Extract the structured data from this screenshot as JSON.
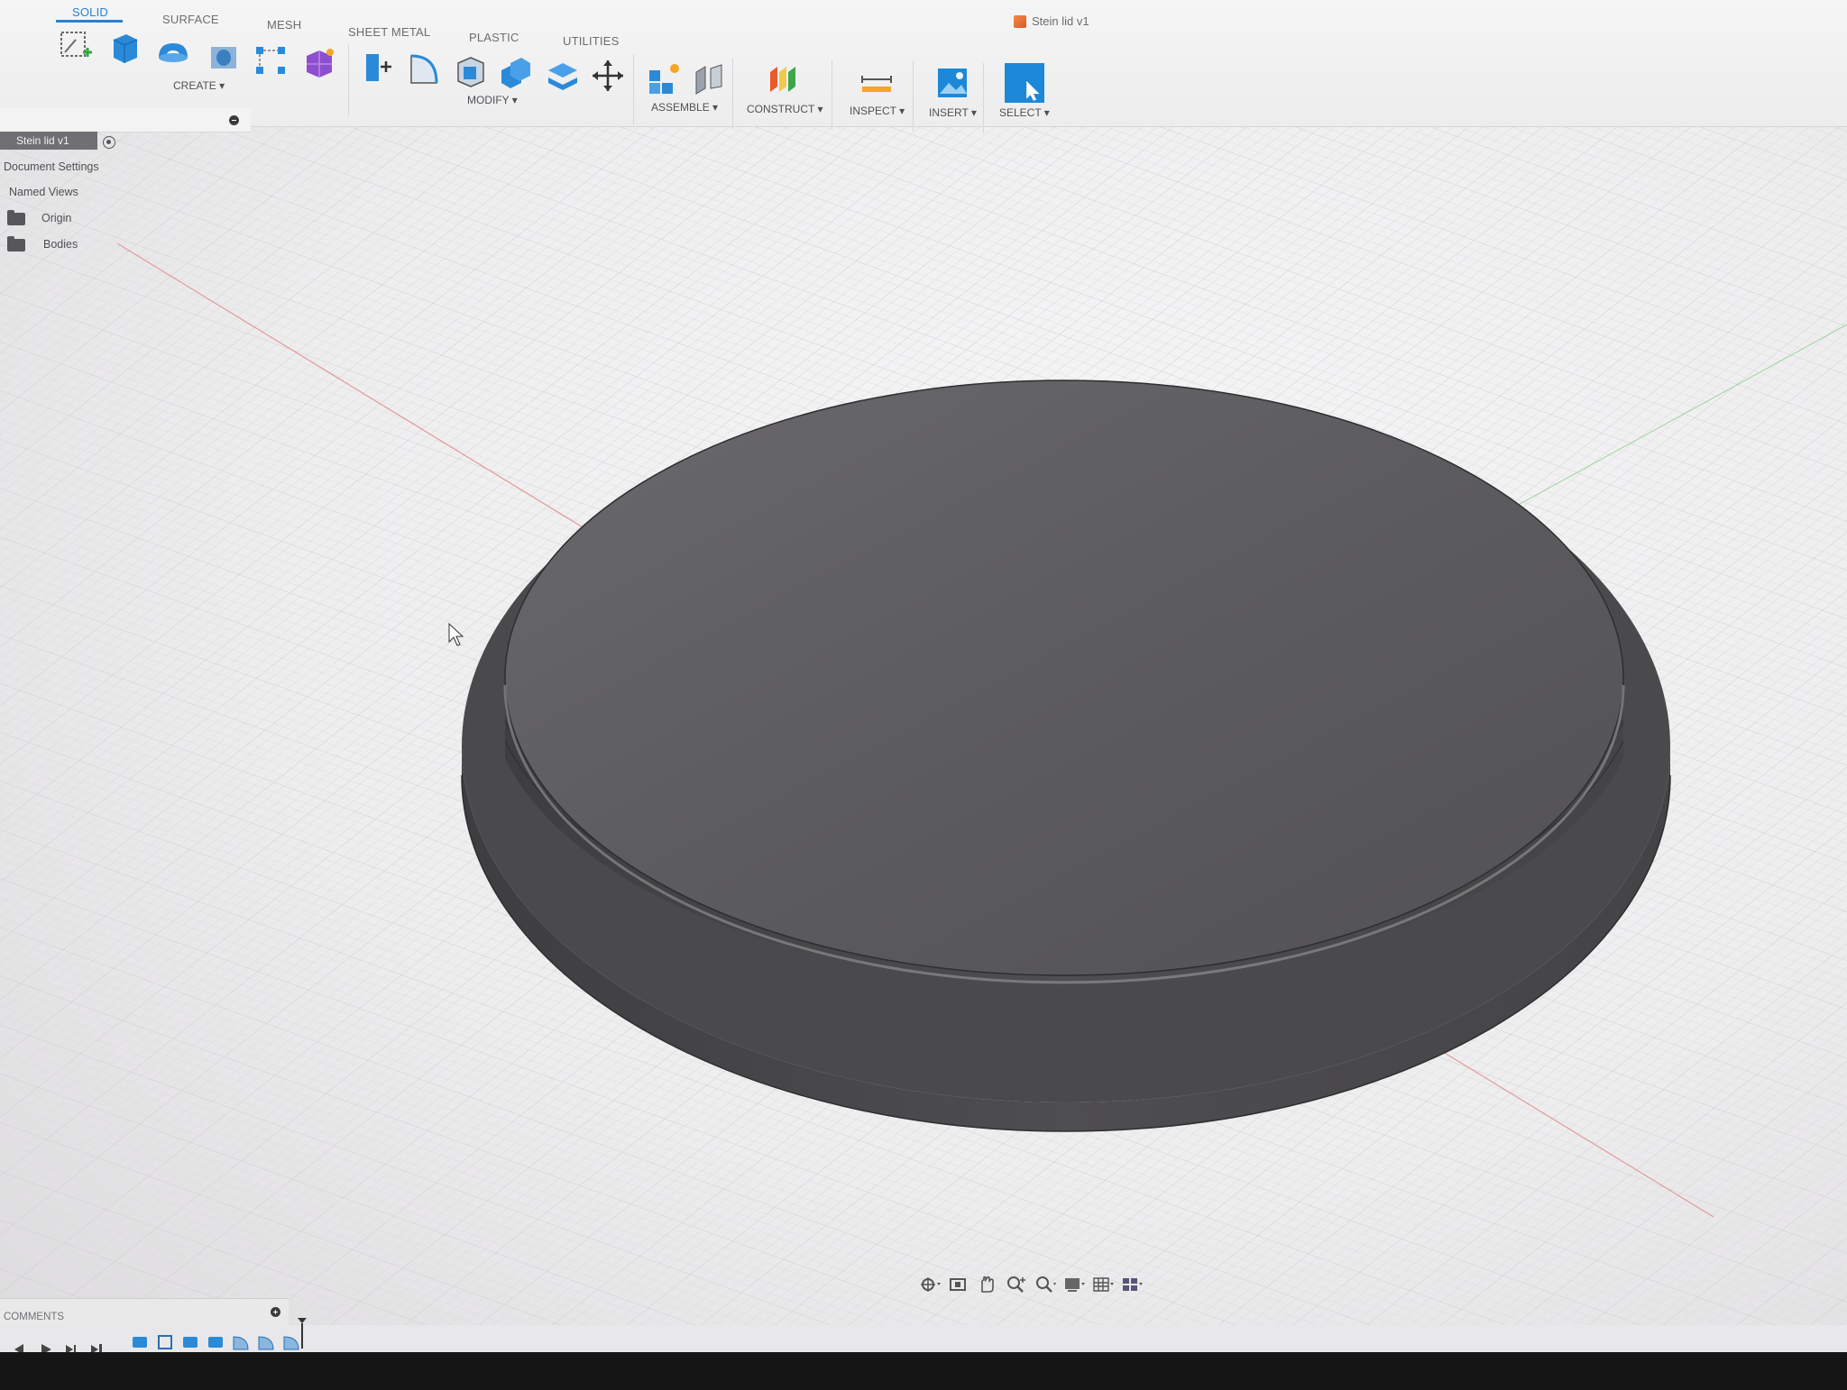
{
  "document": {
    "title": "Stein lid v1"
  },
  "tabs": [
    {
      "label": "SOLID",
      "active": true
    },
    {
      "label": "SURFACE",
      "active": false
    },
    {
      "label": "MESH",
      "active": false
    },
    {
      "label": "SHEET METAL",
      "active": false
    },
    {
      "label": "PLASTIC",
      "active": false
    },
    {
      "label": "UTILITIES",
      "active": false
    }
  ],
  "groups": {
    "create": "CREATE ▾",
    "modify": "MODIFY ▾",
    "assemble": "ASSEMBLE ▾",
    "construct": "CONSTRUCT ▾",
    "inspect": "INSPECT ▾",
    "insert": "INSERT ▾",
    "select": "SELECT ▾"
  },
  "browser": {
    "root": "Stein lid v1",
    "items": [
      "Document Settings",
      "Named Views",
      "Origin",
      "Bodies"
    ]
  },
  "comments": {
    "label": "COMMENTS"
  },
  "colors": {
    "accent": "#2a7fd4",
    "body": "#5f5e60",
    "grid": "#c8c8cc"
  },
  "icons": {
    "toolbar": [
      "create-sketch-icon",
      "extrude-icon",
      "revolve-icon",
      "hole-icon",
      "pattern-icon",
      "create-form-icon",
      "press-pull-icon",
      "fillet-icon",
      "shell-icon",
      "combine-icon",
      "offset-face-icon",
      "move-icon",
      "new-component-icon",
      "joint-icon",
      "construct-plane-icon",
      "measure-icon",
      "insert-canvas-icon",
      "select-icon"
    ],
    "navigation": [
      "orbit-icon",
      "look-at-icon",
      "pan-icon",
      "zoom-icon",
      "fit-icon",
      "display-settings-icon",
      "grid-settings-icon",
      "viewports-icon"
    ]
  }
}
